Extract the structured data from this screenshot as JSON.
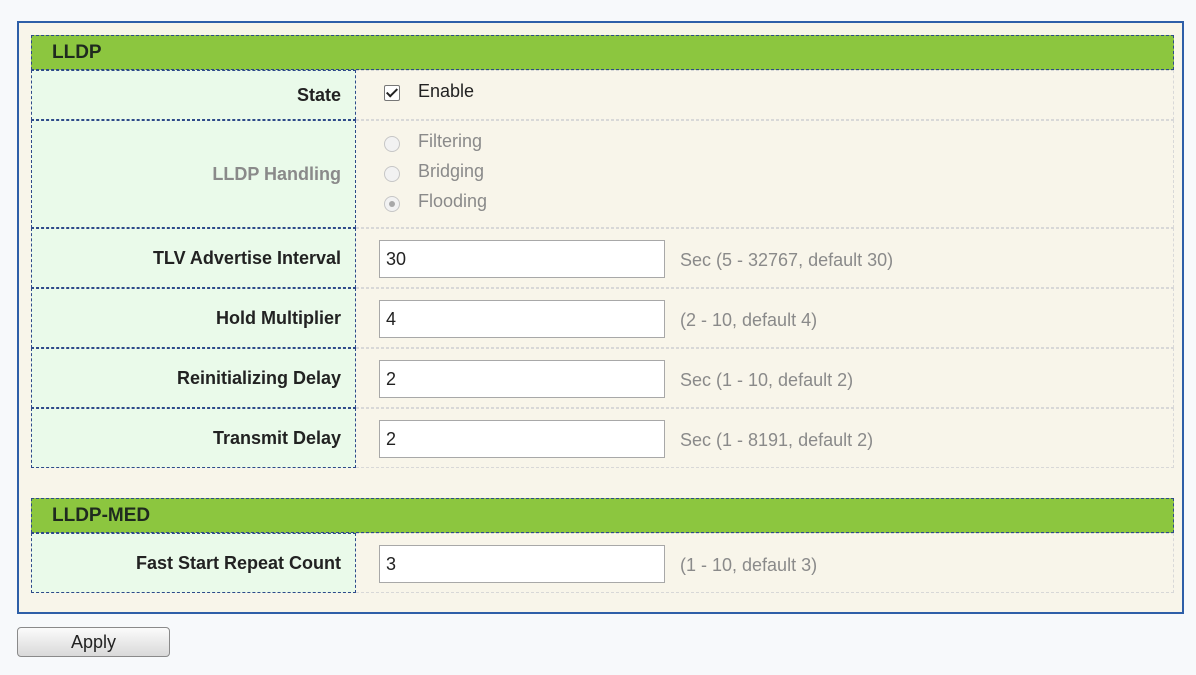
{
  "lldp": {
    "title": "LLDP",
    "state": {
      "label": "State",
      "checked": true,
      "option_label": "Enable"
    },
    "handling": {
      "label": "LLDP Handling",
      "options": [
        "Filtering",
        "Bridging",
        "Flooding"
      ],
      "selected": "Flooding"
    },
    "tlv_interval": {
      "label": "TLV Advertise Interval",
      "value": "30",
      "hint": "Sec (5 - 32767, default 30)"
    },
    "hold_multiplier": {
      "label": "Hold Multiplier",
      "value": "4",
      "hint": "(2 - 10, default 4)"
    },
    "reinit_delay": {
      "label": "Reinitializing Delay",
      "value": "2",
      "hint": "Sec (1 - 10, default 2)"
    },
    "transmit_delay": {
      "label": "Transmit Delay",
      "value": "2",
      "hint": "Sec (1 - 8191, default 2)"
    }
  },
  "lldp_med": {
    "title": "LLDP-MED",
    "fast_start": {
      "label": "Fast Start Repeat Count",
      "value": "3",
      "hint": "(1 - 10, default 3)"
    }
  },
  "apply_label": "Apply"
}
